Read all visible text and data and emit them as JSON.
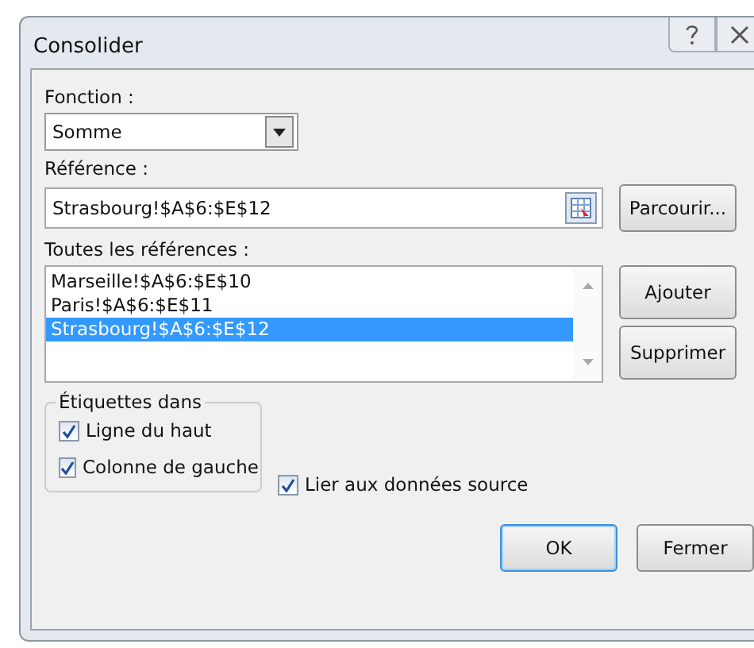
{
  "window": {
    "title": "Consolider"
  },
  "function": {
    "label": "Fonction :",
    "value": "Somme"
  },
  "reference": {
    "label": "Référence :",
    "value": "Strasbourg!$A$6:$E$12",
    "browse_button": "Parcourir..."
  },
  "all_references": {
    "label": "Toutes les références :",
    "items": [
      {
        "text": "Marseille!$A$6:$E$10",
        "selected": false
      },
      {
        "text": "Paris!$A$6:$E$11",
        "selected": false
      },
      {
        "text": "Strasbourg!$A$6:$E$12",
        "selected": true
      }
    ],
    "buttons": [
      "Ajouter",
      "Supprimer"
    ]
  },
  "labels_group": {
    "title": "Étiquettes dans",
    "options": [
      {
        "label": "Ligne du haut",
        "checked": true
      },
      {
        "label": "Colonne de gauche",
        "checked": true
      }
    ]
  },
  "link_source": {
    "label": "Lier aux données source",
    "checked": true
  },
  "footer_buttons": [
    {
      "label": "OK",
      "default": true
    },
    {
      "label": "Fermer",
      "default": false
    }
  ]
}
